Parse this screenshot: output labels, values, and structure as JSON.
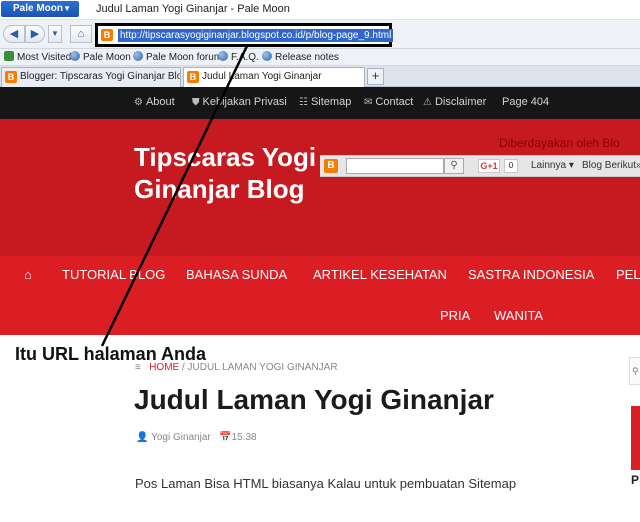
{
  "browser": {
    "app_button": "Pale Moon",
    "window_title": "Judul Laman Yogi Ginanjar - Pale Moon",
    "url": "http://tipscarasyogiginanjar.blogspot.co.id/p/blog-page_9.html",
    "bookmarks": [
      "Most Visited",
      "Pale Moon",
      "Pale Moon forum",
      "F.A.Q.",
      "Release notes"
    ],
    "tabs": [
      {
        "label": "Blogger: Tipscaras Yogi Ginanjar Blog...",
        "active": false
      },
      {
        "label": "Judul Laman Yogi Ginanjar",
        "active": true
      }
    ],
    "new_tab": "+"
  },
  "top_nav": [
    "About",
    "Kebijakan Privasi",
    "Sitemap",
    "Contact",
    "Disclaimer",
    "Page 404"
  ],
  "header": {
    "site_title": "Tipscaras Yogi Ginanjar Blog",
    "powered_prefix": "Diberdayakan oleh",
    "powered_brand": "Blo"
  },
  "blogger_navbar": {
    "gplus": "G+1",
    "count": "0",
    "more": "Lainnya",
    "next_blog": "Blog Berikut»"
  },
  "main_nav": {
    "row1": [
      "TUTORIAL BLOG",
      "BAHASA SUNDA",
      "ARTIKEL KESEHATAN",
      "SASTRA INDONESIA",
      "PEL"
    ],
    "row2": [
      "PRIA",
      "WANITA"
    ]
  },
  "annotation": "Itu URL halaman Anda",
  "content": {
    "breadcrumb_home": "HOME",
    "breadcrumb_current": "/ JUDUL LAMAN YOGI GINANJAR",
    "page_title": "Judul Laman Yogi Ginanjar",
    "author": "Yogi Ginanjar",
    "time": "15.38",
    "paragraph": "Pos Laman Bisa HTML biasanya Kalau untuk pembuatan Sitemap"
  },
  "sidebar": {
    "letter": "P"
  },
  "colors": {
    "header_red": "#c71a20",
    "nav_red": "#db1e24",
    "topnav": "#161616",
    "url_highlight": "#2f66c8"
  }
}
